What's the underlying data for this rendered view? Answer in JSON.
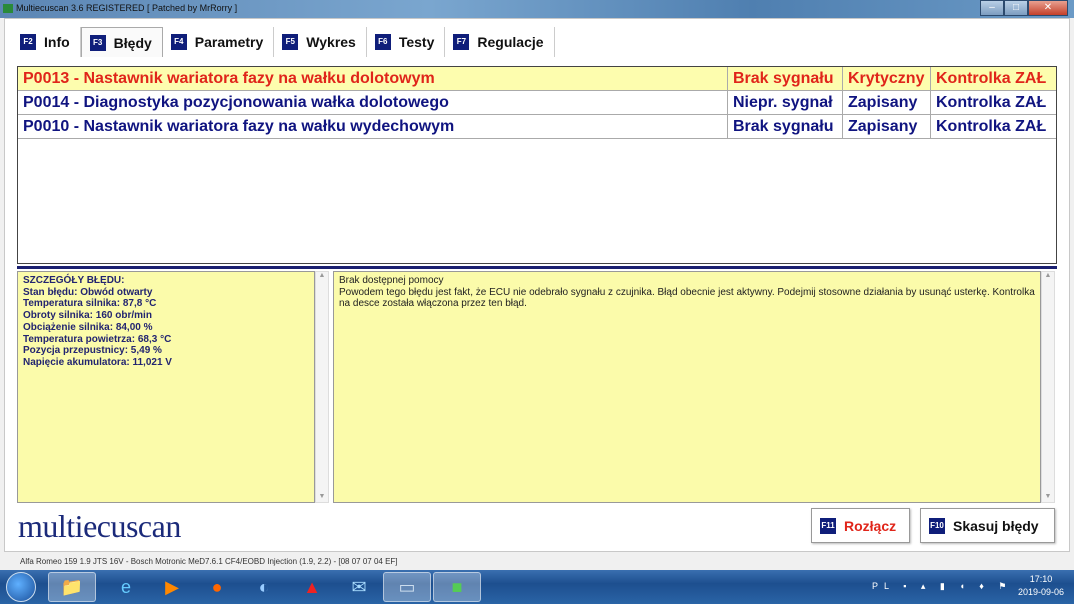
{
  "window": {
    "title": "Multiecuscan 3.6 REGISTERED    [ Patched by MrRorry ]"
  },
  "tabs": [
    {
      "key": "F2",
      "label": "Info"
    },
    {
      "key": "F3",
      "label": "Błędy"
    },
    {
      "key": "F4",
      "label": "Parametry"
    },
    {
      "key": "F5",
      "label": "Wykres"
    },
    {
      "key": "F6",
      "label": "Testy"
    },
    {
      "key": "F7",
      "label": "Regulacje"
    }
  ],
  "errors": [
    {
      "code": "P0013 - Nastawnik wariatora fazy na wałku dolotowym",
      "type": "Brak sygnału",
      "status": "Krytyczny",
      "lamp": "Kontrolka ZAŁ"
    },
    {
      "code": "P0014 - Diagnostyka pozycjonowania wałka dolotowego",
      "type": "Niepr. sygnał",
      "status": "Zapisany",
      "lamp": "Kontrolka ZAŁ"
    },
    {
      "code": "P0010 - Nastawnik wariatora fazy na wałku wydechowym",
      "type": "Brak sygnału",
      "status": "Zapisany",
      "lamp": "Kontrolka ZAŁ"
    }
  ],
  "details": {
    "title": "SZCZEGÓŁY BŁĘDU:",
    "lines": [
      "Stan błędu: Obwód otwarty",
      "Temperatura silnika: 87,8 °C",
      "Obroty silnika: 160 obr/min",
      "Obciążenie silnika: 84,00 %",
      "Temperatura powietrza: 68,3 °C",
      "Pozycja przepustnicy: 5,49 %",
      "Napięcie akumulatora: 11,021 V"
    ]
  },
  "help": {
    "title": "Brak dostępnej pomocy",
    "text": "Powodem tego błędu jest fakt, że ECU nie odebrało sygnału z czujnika. Błąd obecnie jest aktywny. Podejmij stosowne działania by usunąć usterkę. Kontrolka na desce została włączona przez ten błąd."
  },
  "logo": "multiecuscan",
  "buttons": {
    "disconnect": {
      "key": "F11",
      "label": "Rozłącz"
    },
    "clear": {
      "key": "F10",
      "label": "Skasuj błędy"
    }
  },
  "status": "Alfa Romeo 159 1.9 JTS 16V - Bosch Motronic MeD7.6.1 CF4/EOBD Injection (1.9, 2.2) - [08 07 07 04 EF]",
  "taskbar": {
    "lang": "PL",
    "time": "17:10",
    "date": "2019-09-06"
  },
  "colors": {
    "selected_row": "#fdfdae",
    "error_red": "#e0251a",
    "text_blue": "#101480",
    "panel_yellow": "#fbfbaa"
  }
}
